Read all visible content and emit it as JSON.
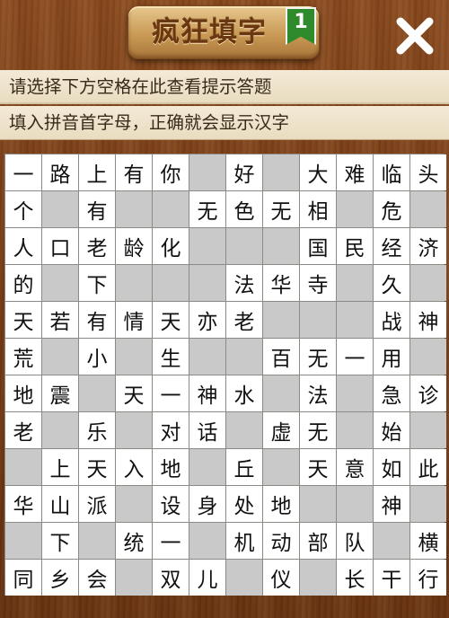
{
  "header": {
    "title": "疯狂填字",
    "level": "1"
  },
  "hints": {
    "line1": "请选择下方空格在此查看提示答题",
    "line2": "填入拼音首字母，正确就会显示汉字"
  },
  "colors": {
    "wood": "#7a3f17",
    "block_cell": "#c9c9c9",
    "white_cell": "#ffffff",
    "badge_green": "#2f8a2c"
  },
  "icons": {
    "close": "close-x-icon",
    "badge": "level-ribbon-icon"
  },
  "grid": {
    "rows": [
      [
        "一",
        "路",
        "上",
        "有",
        "你",
        "#",
        "好",
        "#",
        "大",
        "难",
        "临",
        "头"
      ],
      [
        "个",
        "#",
        "有",
        "#",
        "#",
        "无",
        "色",
        "无",
        "相",
        "#",
        "危",
        "#"
      ],
      [
        "人",
        "口",
        "老",
        "龄",
        "化",
        "#",
        "#",
        "#",
        "国",
        "民",
        "经",
        "济"
      ],
      [
        "的",
        "#",
        "下",
        "#",
        "#",
        "#",
        "法",
        "华",
        "寺",
        "#",
        "久",
        "#"
      ],
      [
        "天",
        "若",
        "有",
        "情",
        "天",
        "亦",
        "老",
        "#",
        "#",
        "#",
        "战",
        "神"
      ],
      [
        "荒",
        "#",
        "小",
        "#",
        "生",
        "#",
        "#",
        "百",
        "无",
        "一",
        "用",
        "#"
      ],
      [
        "地",
        "震",
        "#",
        "天",
        "一",
        "神",
        "水",
        "#",
        "法",
        "#",
        "急",
        "诊"
      ],
      [
        "老",
        "#",
        "乐",
        "#",
        "对",
        "话",
        "#",
        "虚",
        "无",
        "#",
        "始",
        "#"
      ],
      [
        "#",
        "上",
        "天",
        "入",
        "地",
        "#",
        "丘",
        "#",
        "天",
        "意",
        "如",
        "此"
      ],
      [
        "华",
        "山",
        "派",
        "#",
        "设",
        "身",
        "处",
        "地",
        "#",
        "#",
        "神",
        "#"
      ],
      [
        "#",
        "下",
        "#",
        "统",
        "一",
        "#",
        "机",
        "动",
        "部",
        "队",
        "#",
        "横"
      ],
      [
        "同",
        "乡",
        "会",
        "#",
        "双",
        "儿",
        "#",
        "仪",
        "#",
        "长",
        "干",
        "行"
      ]
    ]
  }
}
